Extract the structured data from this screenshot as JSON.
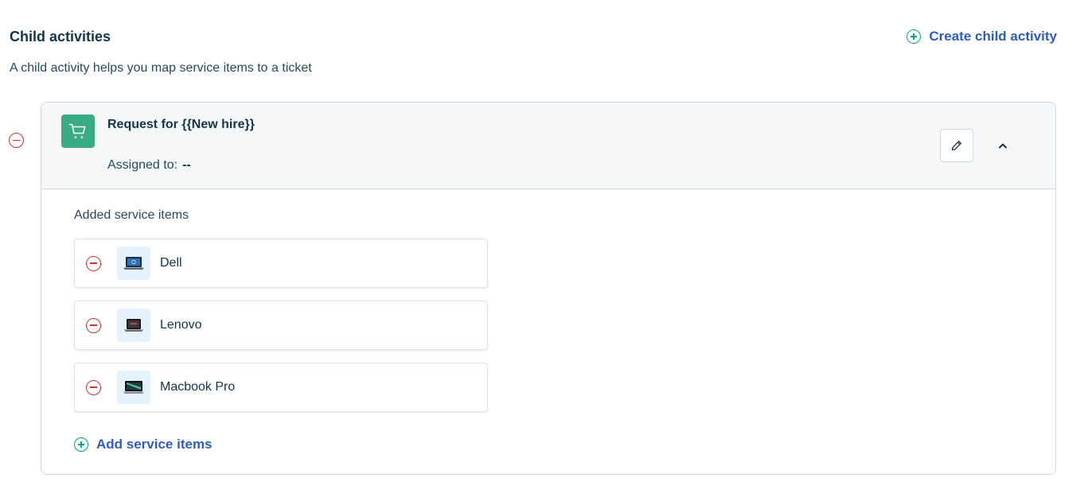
{
  "section": {
    "title": "Child activities",
    "description": "A child activity helps you map service items to a ticket",
    "create_label": "Create child activity"
  },
  "activity": {
    "title": "Request for {{New hire}}",
    "assigned_label": "Assigned to:",
    "assigned_value": "--",
    "icon": "shopping-cart-icon",
    "accent_color": "#3bab83"
  },
  "service_items": {
    "heading": "Added service items",
    "items": [
      {
        "name": "Dell",
        "icon": "laptop-icon"
      },
      {
        "name": "Lenovo",
        "icon": "laptop-icon"
      },
      {
        "name": "Macbook Pro",
        "icon": "laptop-icon"
      }
    ],
    "add_label": "Add service items"
  },
  "colors": {
    "link": "#2c5cc5",
    "add": "#00a886",
    "remove": "#d72d30"
  }
}
